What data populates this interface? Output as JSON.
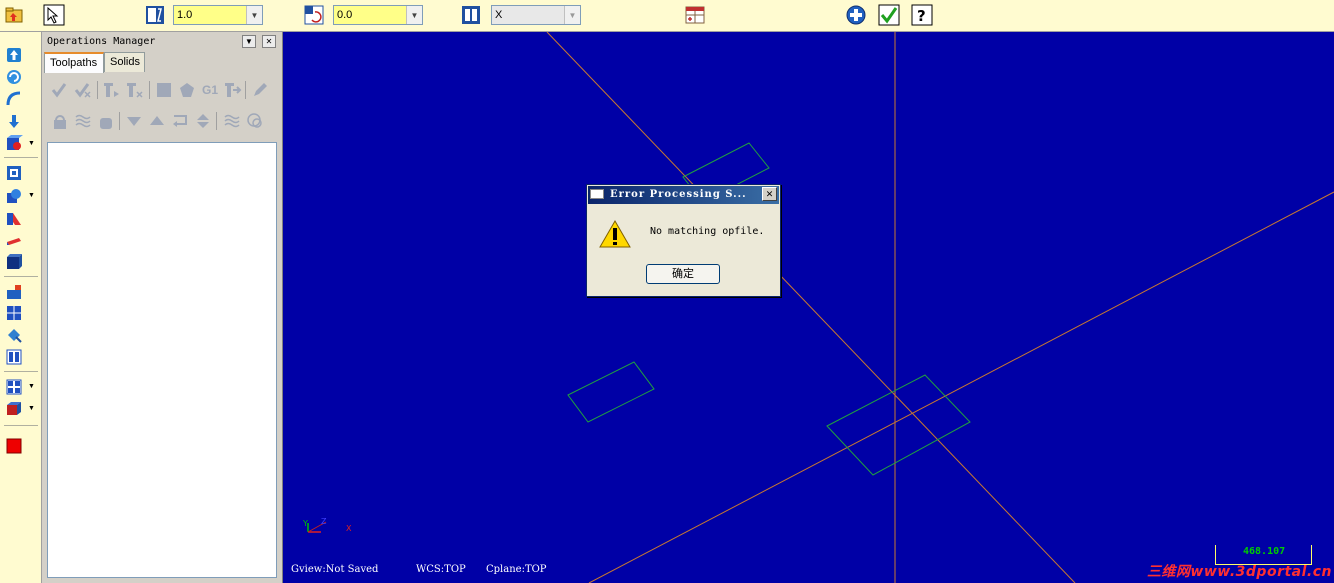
{
  "toolbar": {
    "combo_1": {
      "value": "1.0"
    },
    "combo_2": {
      "value": "0.0"
    },
    "combo_3": {
      "value": "X"
    }
  },
  "ops_manager": {
    "title": "Operations Manager",
    "tabs": [
      {
        "label": "Toolpaths"
      },
      {
        "label": "Solids"
      }
    ],
    "tool_g1_label": "G1"
  },
  "viewport": {
    "status": {
      "gview": "Gview:Not Saved",
      "wcs": "WCS:TOP",
      "cplane": "Cplane:TOP"
    },
    "scale": "468.107",
    "axis_labels": {
      "y": "Y",
      "z": "Z",
      "x": "X"
    },
    "watermark": "三维网www.3dportal.cn"
  },
  "dialog": {
    "title": "Error Processing S...",
    "message": "No matching opfile.",
    "ok_label": "确定"
  },
  "colors": {
    "viewport_bg": "#0000a6",
    "axis_line": "#c87830",
    "geometry": "#20a040",
    "toolbar_bg": "#fffbd0"
  }
}
